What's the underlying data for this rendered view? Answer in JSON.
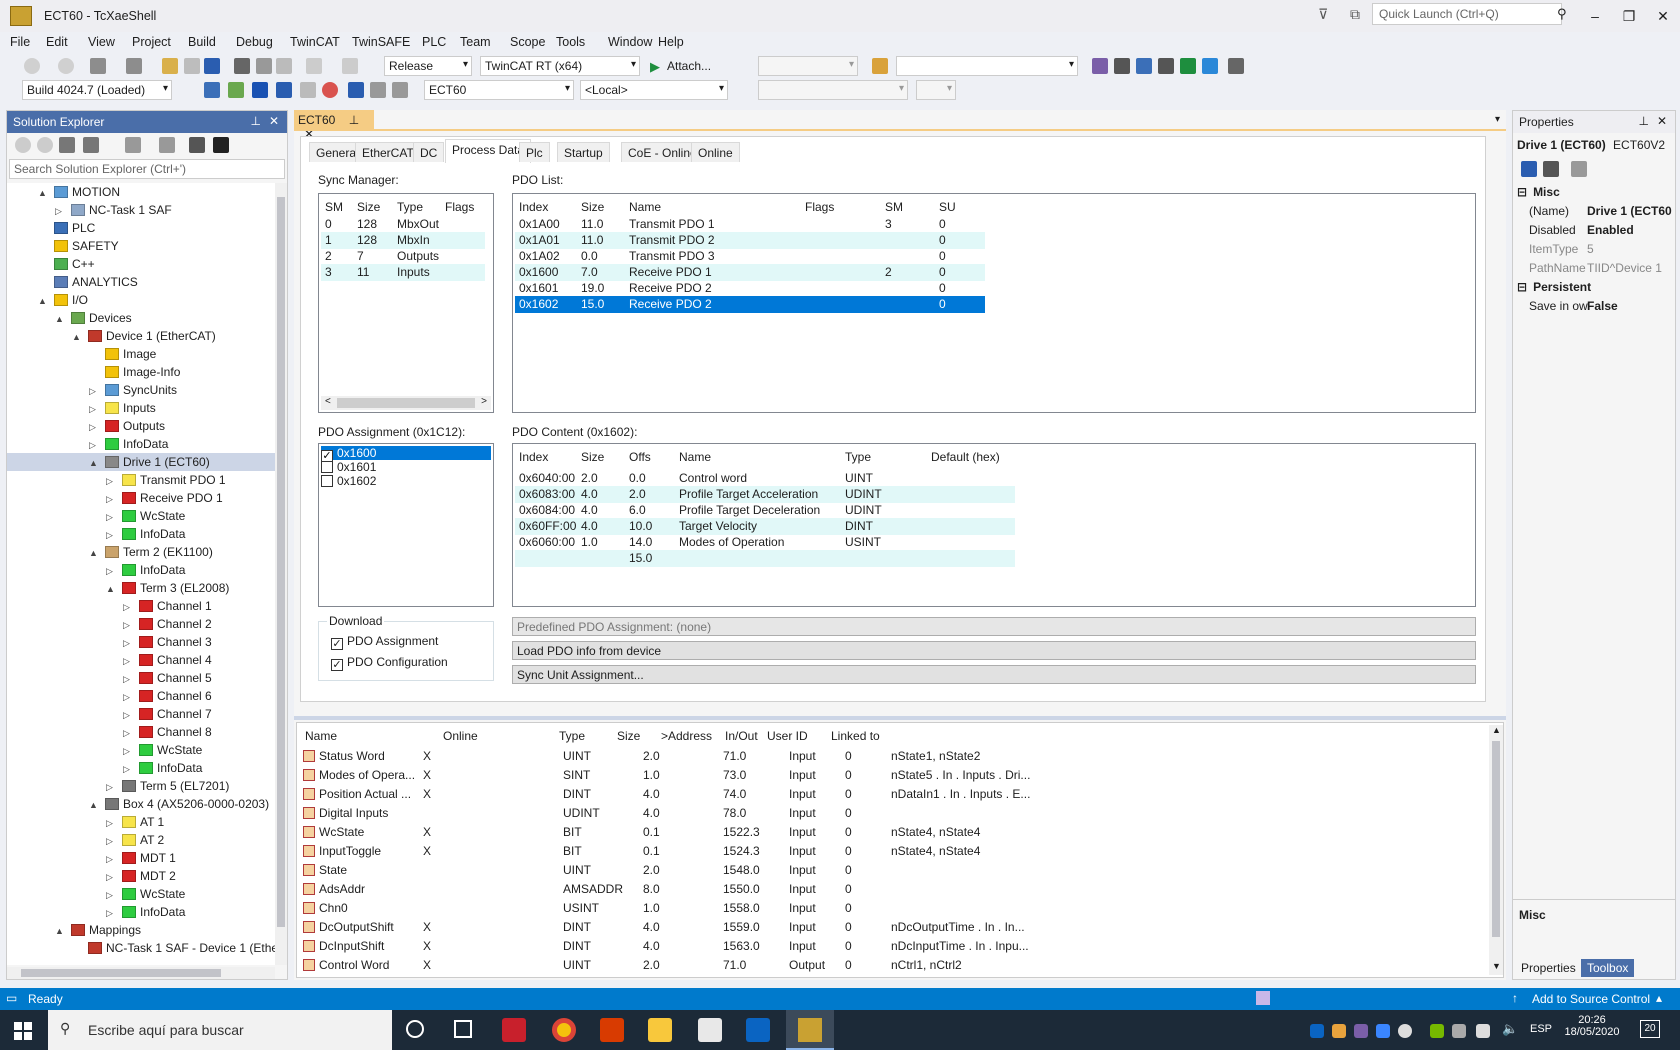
{
  "window": {
    "title": "ECT60 - TcXaeShell",
    "quick_launch": "Quick Launch (Ctrl+Q)"
  },
  "menu": [
    "File",
    "Edit",
    "View",
    "Project",
    "Build",
    "Debug",
    "TwinCAT",
    "TwinSAFE",
    "PLC",
    "Team",
    "Scope",
    "Tools",
    "Window",
    "Help"
  ],
  "toolbar1": {
    "config": "Release",
    "platform": "TwinCAT RT (x64)",
    "attach": "Attach..."
  },
  "toolbar2": {
    "build": "Build 4024.7 (Loaded)",
    "target": "ECT60",
    "route": "<Local>"
  },
  "solution_explorer": {
    "title": "Solution Explorer",
    "search_placeholder": "Search Solution Explorer (Ctrl+')",
    "tree": [
      {
        "label": "MOTION",
        "d": 1,
        "t": "▲",
        "c": "#5b9bd5"
      },
      {
        "label": "NC-Task 1 SAF",
        "d": 2,
        "t": "▷",
        "c": "#8fa8c8"
      },
      {
        "label": "PLC",
        "d": 1,
        "t": "",
        "c": "#3a6fb7"
      },
      {
        "label": "SAFETY",
        "d": 1,
        "t": "",
        "c": "#f2c20a"
      },
      {
        "label": "C++",
        "d": 1,
        "t": "",
        "c": "#4caf50"
      },
      {
        "label": "ANALYTICS",
        "d": 1,
        "t": "",
        "c": "#5b7db7"
      },
      {
        "label": "I/O",
        "d": 1,
        "t": "▲",
        "c": "#f2c20a"
      },
      {
        "label": "Devices",
        "d": 2,
        "t": "▲",
        "c": "#6aa84f"
      },
      {
        "label": "Device 1 (EtherCAT)",
        "d": 3,
        "t": "▲",
        "c": "#c0392b"
      },
      {
        "label": "Image",
        "d": 4,
        "t": "",
        "c": "#f2c20a"
      },
      {
        "label": "Image-Info",
        "d": 4,
        "t": "",
        "c": "#f2c20a"
      },
      {
        "label": "SyncUnits",
        "d": 4,
        "t": "▷",
        "c": "#5b9bd5"
      },
      {
        "label": "Inputs",
        "d": 4,
        "t": "▷",
        "c": "#f7e44a"
      },
      {
        "label": "Outputs",
        "d": 4,
        "t": "▷",
        "c": "#d62424"
      },
      {
        "label": "InfoData",
        "d": 4,
        "t": "▷",
        "c": "#2ecc40"
      },
      {
        "label": "Drive 1 (ECT60)",
        "d": 4,
        "t": "▲",
        "c": "#888888",
        "sel": true
      },
      {
        "label": "Transmit PDO 1",
        "d": 5,
        "t": "▷",
        "c": "#f7e44a"
      },
      {
        "label": "Receive PDO 1",
        "d": 5,
        "t": "▷",
        "c": "#d62424"
      },
      {
        "label": "WcState",
        "d": 5,
        "t": "▷",
        "c": "#2ecc40"
      },
      {
        "label": "InfoData",
        "d": 5,
        "t": "▷",
        "c": "#2ecc40"
      },
      {
        "label": "Term 2 (EK1100)",
        "d": 4,
        "t": "▲",
        "c": "#caa36b"
      },
      {
        "label": "InfoData",
        "d": 5,
        "t": "▷",
        "c": "#2ecc40"
      },
      {
        "label": "Term 3 (EL2008)",
        "d": 5,
        "t": "▲",
        "c": "#d62424"
      },
      {
        "label": "Channel 1",
        "d": 6,
        "t": "▷",
        "c": "#d62424"
      },
      {
        "label": "Channel 2",
        "d": 6,
        "t": "▷",
        "c": "#d62424"
      },
      {
        "label": "Channel 3",
        "d": 6,
        "t": "▷",
        "c": "#d62424"
      },
      {
        "label": "Channel 4",
        "d": 6,
        "t": "▷",
        "c": "#d62424"
      },
      {
        "label": "Channel 5",
        "d": 6,
        "t": "▷",
        "c": "#d62424"
      },
      {
        "label": "Channel 6",
        "d": 6,
        "t": "▷",
        "c": "#d62424"
      },
      {
        "label": "Channel 7",
        "d": 6,
        "t": "▷",
        "c": "#d62424"
      },
      {
        "label": "Channel 8",
        "d": 6,
        "t": "▷",
        "c": "#d62424"
      },
      {
        "label": "WcState",
        "d": 6,
        "t": "▷",
        "c": "#2ecc40"
      },
      {
        "label": "InfoData",
        "d": 6,
        "t": "▷",
        "c": "#2ecc40"
      },
      {
        "label": "Term 5 (EL7201)",
        "d": 5,
        "t": "▷",
        "c": "#777777"
      },
      {
        "label": "Box 4 (AX5206-0000-0203)",
        "d": 4,
        "t": "▲",
        "c": "#777777"
      },
      {
        "label": "AT 1",
        "d": 5,
        "t": "▷",
        "c": "#f7e44a"
      },
      {
        "label": "AT 2",
        "d": 5,
        "t": "▷",
        "c": "#f7e44a"
      },
      {
        "label": "MDT 1",
        "d": 5,
        "t": "▷",
        "c": "#d62424"
      },
      {
        "label": "MDT 2",
        "d": 5,
        "t": "▷",
        "c": "#d62424"
      },
      {
        "label": "WcState",
        "d": 5,
        "t": "▷",
        "c": "#2ecc40"
      },
      {
        "label": "InfoData",
        "d": 5,
        "t": "▷",
        "c": "#2ecc40"
      },
      {
        "label": "Mappings",
        "d": 2,
        "t": "▲",
        "c": "#c0392b"
      },
      {
        "label": "NC-Task 1 SAF - Device 1 (Ethe",
        "d": 3,
        "t": "",
        "c": "#c0392b"
      }
    ]
  },
  "doc": {
    "tab": "ECT60",
    "tabs": [
      "General",
      "EtherCAT",
      "DC",
      "Process Data",
      "Plc",
      "Startup",
      "CoE - Online",
      "Online"
    ],
    "sync_manager": {
      "label": "Sync Manager:",
      "headers": [
        "SM",
        "Size",
        "Type",
        "Flags"
      ],
      "rows": [
        [
          "0",
          "128",
          "MbxOut",
          ""
        ],
        [
          "1",
          "128",
          "MbxIn",
          ""
        ],
        [
          "2",
          "7",
          "Outputs",
          ""
        ],
        [
          "3",
          "11",
          "Inputs",
          ""
        ]
      ]
    },
    "pdo_list": {
      "label": "PDO List:",
      "headers": [
        "Index",
        "Size",
        "Name",
        "Flags",
        "SM",
        "SU"
      ],
      "rows": [
        [
          "0x1A00",
          "11.0",
          "Transmit PDO 1",
          "",
          "3",
          "0"
        ],
        [
          "0x1A01",
          "11.0",
          "Transmit PDO 2",
          "",
          "",
          "0"
        ],
        [
          "0x1A02",
          "0.0",
          "Transmit PDO 3",
          "",
          "",
          "0"
        ],
        [
          "0x1600",
          "7.0",
          "Receive PDO 1",
          "",
          "2",
          "0"
        ],
        [
          "0x1601",
          "19.0",
          "Receive PDO 2",
          "",
          "",
          "0"
        ],
        [
          "0x1602",
          "15.0",
          "Receive PDO 2",
          "",
          "",
          "0"
        ]
      ]
    },
    "pdo_assignment": {
      "label": "PDO Assignment (0x1C12):",
      "items": [
        {
          "label": "0x1600",
          "checked": "✓"
        },
        {
          "label": "0x1601",
          "checked": ""
        },
        {
          "label": "0x1602",
          "checked": ""
        }
      ]
    },
    "pdo_content": {
      "label": "PDO Content (0x1602):",
      "headers": [
        "Index",
        "Size",
        "Offs",
        "Name",
        "Type",
        "Default (hex)"
      ],
      "rows": [
        [
          "0x6040:00",
          "2.0",
          "0.0",
          "Control word",
          "UINT",
          ""
        ],
        [
          "0x6083:00",
          "4.0",
          "2.0",
          "Profile Target Acceleration",
          "UDINT",
          ""
        ],
        [
          "0x6084:00",
          "4.0",
          "6.0",
          "Profile Target Deceleration",
          "UDINT",
          ""
        ],
        [
          "0x60FF:00",
          "4.0",
          "10.0",
          "Target Velocity",
          "DINT",
          ""
        ],
        [
          "0x6060:00",
          "1.0",
          "14.0",
          "Modes of Operation",
          "USINT",
          ""
        ],
        [
          "",
          "",
          "15.0",
          "",
          "",
          ""
        ]
      ]
    },
    "download": {
      "label": "Download",
      "pdo_assignment": "PDO Assignment",
      "pdo_configuration": "PDO Configuration"
    },
    "predefined": "Predefined PDO Assignment: (none)",
    "load_btn": "Load PDO info from device",
    "sync_unit_btn": "Sync Unit Assignment..."
  },
  "vars": {
    "headers": [
      "Name",
      "Online",
      "Type",
      "Size",
      ">Address",
      "In/Out",
      "User ID",
      "Linked to"
    ],
    "rows": [
      [
        "Status Word",
        "X",
        "",
        "UINT",
        "2.0",
        "71.0",
        "Input",
        "0",
        "nState1, nState2"
      ],
      [
        "Modes of Opera...",
        "X",
        "",
        "SINT",
        "1.0",
        "73.0",
        "Input",
        "0",
        "nState5 . In . Inputs . Dri..."
      ],
      [
        "Position Actual ...",
        "X",
        "",
        "DINT",
        "4.0",
        "74.0",
        "Input",
        "0",
        "nDataIn1 . In . Inputs . E..."
      ],
      [
        "Digital Inputs",
        "",
        "",
        "UDINT",
        "4.0",
        "78.0",
        "Input",
        "0",
        ""
      ],
      [
        "WcState",
        "X",
        "",
        "BIT",
        "0.1",
        "1522.3",
        "Input",
        "0",
        "nState4, nState4"
      ],
      [
        "InputToggle",
        "X",
        "",
        "BIT",
        "0.1",
        "1524.3",
        "Input",
        "0",
        "nState4, nState4"
      ],
      [
        "State",
        "",
        "",
        "UINT",
        "2.0",
        "1548.0",
        "Input",
        "0",
        ""
      ],
      [
        "AdsAddr",
        "",
        "",
        "AMSADDR",
        "8.0",
        "1550.0",
        "Input",
        "0",
        ""
      ],
      [
        "Chn0",
        "",
        "",
        "USINT",
        "1.0",
        "1558.0",
        "Input",
        "0",
        ""
      ],
      [
        "DcOutputShift",
        "X",
        "",
        "DINT",
        "4.0",
        "1559.0",
        "Input",
        "0",
        "nDcOutputTime . In . In..."
      ],
      [
        "DcInputShift",
        "X",
        "",
        "DINT",
        "4.0",
        "1563.0",
        "Input",
        "0",
        "nDcInputTime . In . Inpu..."
      ],
      [
        "Control Word",
        "X",
        "",
        "UINT",
        "2.0",
        "71.0",
        "Output",
        "0",
        "nCtrl1, nCtrl2"
      ]
    ]
  },
  "properties": {
    "title": "Properties",
    "object": "Drive 1 (ECT60)",
    "object_type": "ECT60V2",
    "cat_misc": "Misc",
    "cat_persistent": "Persistent",
    "rows": [
      {
        "k": "(Name)",
        "v": "Drive 1 (ECT60"
      },
      {
        "k": "Disabled",
        "v": "Enabled"
      },
      {
        "k": "ItemType",
        "v": "5"
      },
      {
        "k": "PathName",
        "v": "TIID^Device 1"
      }
    ],
    "persist_rows": [
      {
        "k": "Save in ow",
        "v": "False"
      }
    ],
    "desc": "Misc",
    "tab1": "Properties",
    "tab2": "Toolbox"
  },
  "status": {
    "text": "Ready",
    "source_control": "Add to Source Control"
  },
  "taskbar": {
    "search": "Escribe aquí para buscar",
    "lang": "ESP",
    "time": "20:26",
    "date": "18/05/2020",
    "notif": "20"
  }
}
